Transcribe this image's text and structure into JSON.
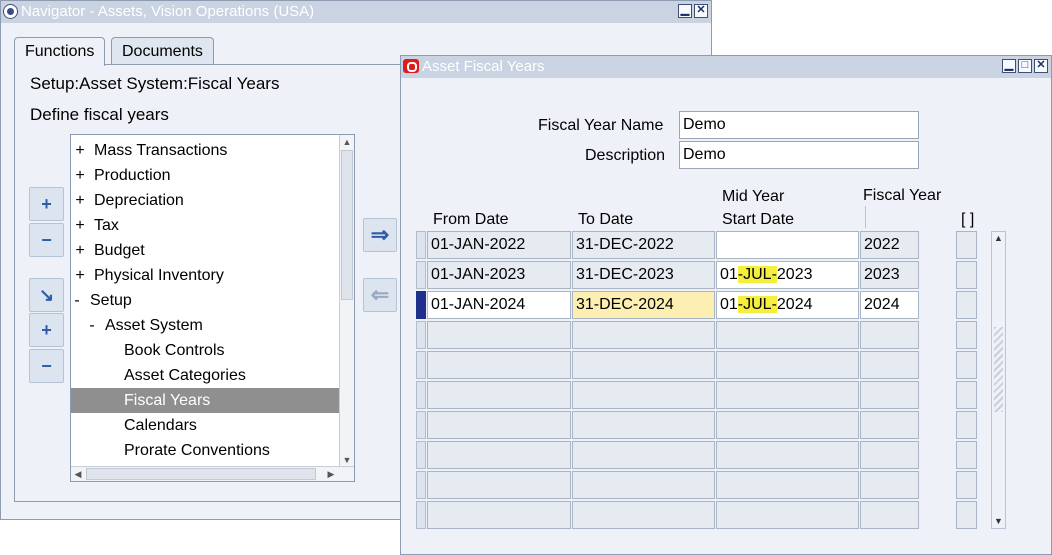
{
  "navigator": {
    "title": "Navigator - Assets, Vision Operations (USA)",
    "tabs": [
      "Functions",
      "Documents"
    ],
    "path": "Setup:Asset System:Fiscal Years",
    "description": "Define fiscal years",
    "tree": [
      {
        "sym": "+",
        "label": "Mass Transactions"
      },
      {
        "sym": "+",
        "label": "Production"
      },
      {
        "sym": "+",
        "label": "Depreciation"
      },
      {
        "sym": "+",
        "label": "Tax"
      },
      {
        "sym": "+",
        "label": "Budget"
      },
      {
        "sym": "+",
        "label": "Physical Inventory"
      },
      {
        "sym": "-",
        "label": "Setup"
      },
      {
        "sym": "-",
        "label": "Asset System"
      },
      {
        "sym": "",
        "label": "Book Controls"
      },
      {
        "sym": "",
        "label": "Asset Categories"
      },
      {
        "sym": "",
        "label": "Fiscal Years"
      },
      {
        "sym": "",
        "label": "Calendars"
      },
      {
        "sym": "",
        "label": "Prorate Conventions"
      }
    ],
    "side_buttons": [
      "+",
      "−",
      "↘",
      "+",
      "−"
    ],
    "arrows": [
      "⇒",
      "⇐"
    ]
  },
  "fiscal": {
    "title": "Asset Fiscal Years",
    "name_label": "Fiscal Year Name",
    "name_value": "Demo",
    "desc_label": "Description",
    "desc_value": "Demo",
    "col_from": "From Date",
    "col_to": "To Date",
    "col_mid_1": "Mid Year",
    "col_mid_2": "Start Date",
    "col_fy": "Fiscal Year",
    "col_box": "[ ]",
    "rows": [
      {
        "from": "01-JAN-2022",
        "to": "31-DEC-2022",
        "mid": "",
        "fy": "2022"
      },
      {
        "from": "01-JAN-2023",
        "to": "31-DEC-2023",
        "mid": "01-JUL-2023",
        "fy": "2023"
      },
      {
        "from": "01-JAN-2024",
        "to": "31-DEC-2024",
        "mid": "01-JUL-2024",
        "fy": "2024"
      }
    ],
    "empty_rows": 7
  },
  "colors": {
    "titlebar_inactive": "#c9d3e2",
    "current_record": "#1e2f8c",
    "highlight": "#f6ee3c",
    "cell_focus": "#fdefb2",
    "tree_selected": "#8f8f8f"
  }
}
